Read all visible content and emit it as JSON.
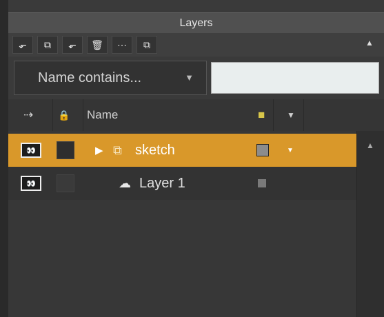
{
  "panel": {
    "title": "Layers"
  },
  "toolbar": {
    "buttons": [
      {
        "name": "new-layer-button",
        "icon": "⬐"
      },
      {
        "name": "duplicate-layer-button",
        "icon": "⧉"
      },
      {
        "name": "new-group-button",
        "icon": "⬐"
      },
      {
        "name": "delete-layer-button",
        "icon": "🗑"
      },
      {
        "name": "more-options-button",
        "icon": "⋯"
      },
      {
        "name": "merge-layers-button",
        "icon": "⧉"
      }
    ],
    "collapse_icon": "▲"
  },
  "filter": {
    "label": "Name contains...",
    "dropdown_icon": "▼",
    "value": ""
  },
  "header": {
    "link_icon": "⇢",
    "lock_icon": "🔒",
    "name_label": "Name",
    "color_icon": "■",
    "sort_icon": "▼"
  },
  "layers": [
    {
      "name": "sketch",
      "type": "group",
      "selected": true,
      "expand_icon": "▶",
      "visibility_icon": "👀"
    },
    {
      "name": "Layer 1",
      "type": "layer",
      "selected": false,
      "visibility_icon": "👀"
    }
  ],
  "scrollbar": {
    "up_icon": "▲"
  },
  "colors": {
    "selected": "#d9982a",
    "panel": "#3a3a3a"
  }
}
